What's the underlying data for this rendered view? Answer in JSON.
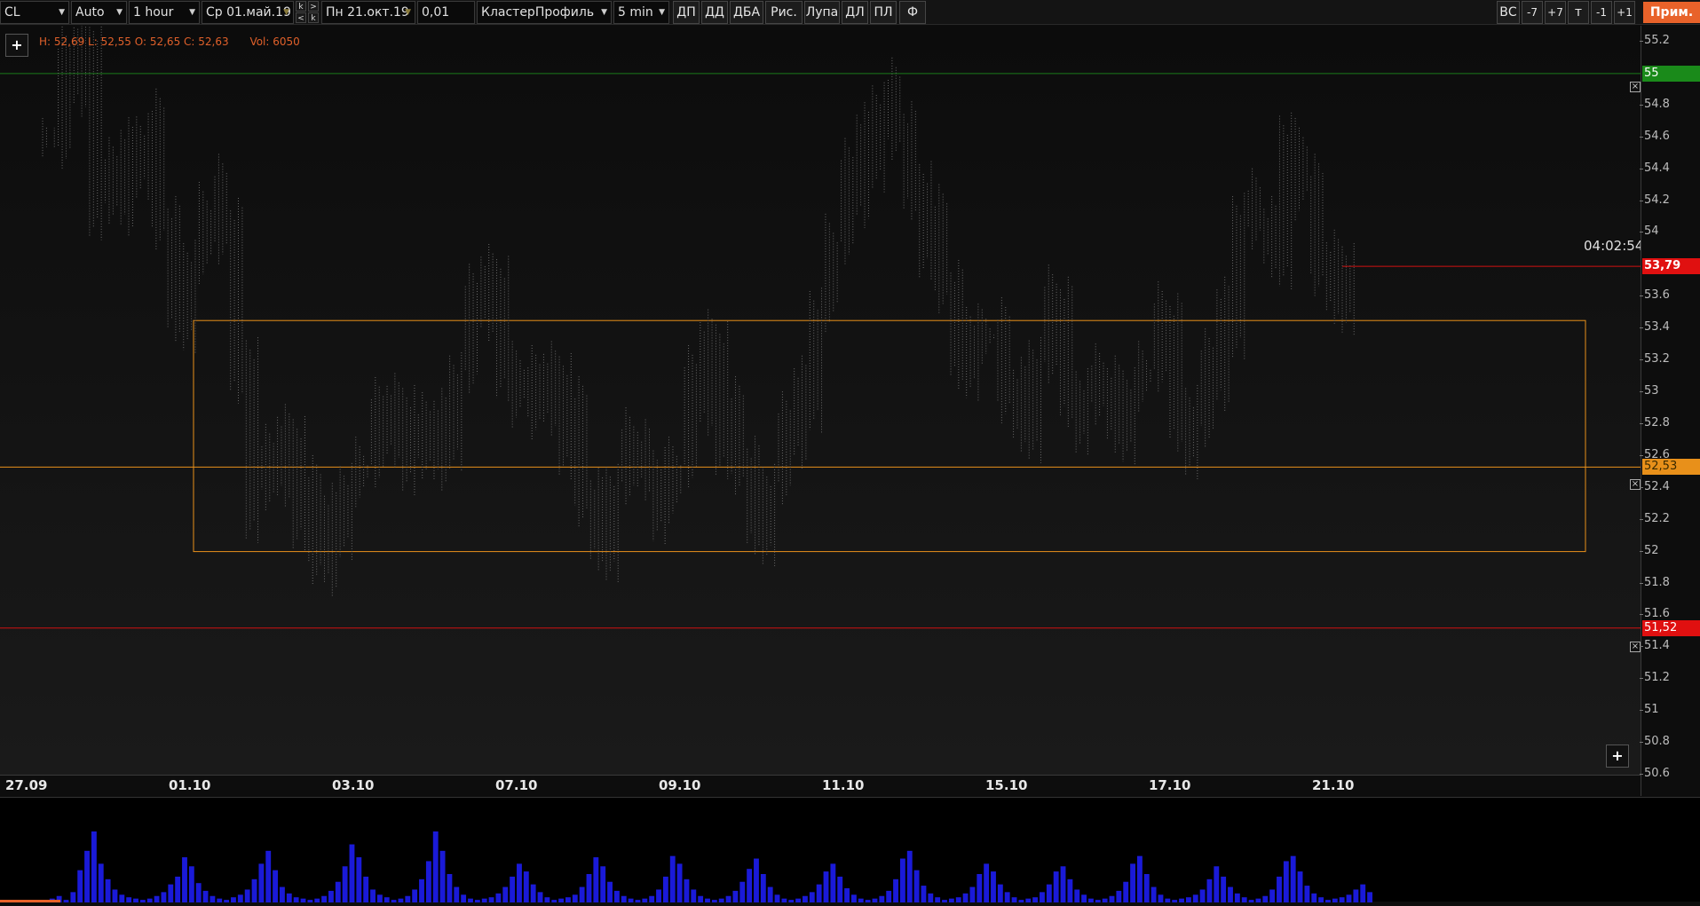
{
  "toolbar": {
    "symbol": "CL",
    "scale": "Auto",
    "timeframe": "1 hour",
    "date_from": "Ср 01.май.19",
    "date_to": "Пн 21.окт.19",
    "k_buttons": [
      ">",
      "<"
    ],
    "tick_size": "0,01",
    "indicator": "КластерПрофиль",
    "cluster_period": "5 min",
    "buttons": [
      "ДП",
      "ДД",
      "ДБА",
      "Рис.",
      "Лупа",
      "ДЛ",
      "ПЛ",
      "Ф"
    ],
    "right_buttons": [
      "ВС",
      "-7",
      "+7",
      "т",
      "-1",
      "+1"
    ],
    "prim_label": "Прим."
  },
  "chart_info": {
    "hl": "H: 52,69 L: 52,55 O: 52,65 C: 52,63",
    "vol": "Vol: 6050"
  },
  "timer": "04:02:54",
  "y_axis": {
    "ticks": [
      "55.2",
      "54.8",
      "54.6",
      "54.4",
      "54.2",
      "54",
      "53.6",
      "53.4",
      "53.2",
      "53",
      "52.8",
      "52.6",
      "52.4",
      "52.2",
      "52",
      "51.8",
      "51.6",
      "51.4",
      "51.2",
      "51",
      "50.8",
      "50.6"
    ]
  },
  "price_labels": [
    {
      "text": "55",
      "color": "#1a8a1a"
    },
    {
      "text": "53,79",
      "color": "#e01010"
    },
    {
      "text": "52,53",
      "color": "#e8901a"
    },
    {
      "text": "51,52",
      "color": "#e01010"
    }
  ],
  "x_axis": {
    "ticks": [
      "27.09",
      "01.10",
      "03.10",
      "07.10",
      "09.10",
      "11.10",
      "15.10",
      "17.10",
      "21.10"
    ]
  },
  "colors": {
    "support_line": "#d01010",
    "resistance_line": "#1a7a1a",
    "mid_line": "#e8901a",
    "rect": "#e8901a",
    "volume": "#1a1ad8",
    "accent": "#e8622a"
  },
  "chart_data": {
    "type": "bar",
    "description_units": "price",
    "ylim": [
      50.6,
      55.3
    ],
    "levels": [
      55,
      53.79,
      52.53,
      51.52
    ],
    "zone": [
      52.0,
      53.45
    ],
    "series": [
      {
        "name": "close",
        "values": [
          54.6,
          55.0,
          55.2,
          54.3,
          54.2,
          54.5,
          54.6,
          54.0,
          53.5,
          53.8,
          54.2,
          54.0,
          53.2,
          52.4,
          52.5,
          52.7,
          52.3,
          51.9,
          52.2,
          52.4,
          52.6,
          52.8,
          52.9,
          52.7,
          52.6,
          52.8,
          53.1,
          53.5,
          53.7,
          53.2,
          52.9,
          53.0,
          53.1,
          52.8,
          52.3,
          52.1,
          52.4,
          52.6,
          52.5,
          52.3,
          52.6,
          53.0,
          53.3,
          52.8,
          52.5,
          52.2,
          52.4,
          52.7,
          53.0,
          53.5,
          54.0,
          54.3,
          54.6,
          54.8,
          54.6,
          54.3,
          54.0,
          53.6,
          53.2,
          53.4,
          53.3,
          53.0,
          52.9,
          53.2,
          53.5,
          53.0,
          52.9,
          53.0,
          52.8,
          53.0,
          53.2,
          53.4,
          52.9,
          52.8,
          53.1,
          53.5,
          54.1,
          54.0,
          53.9,
          54.6,
          54.2,
          53.8,
          53.7,
          53.79
        ]
      }
    ]
  },
  "volume_data": [
    2,
    3,
    5,
    2,
    8,
    25,
    40,
    55,
    30,
    18,
    10,
    6,
    4,
    3,
    2,
    3,
    5,
    8,
    14,
    20,
    35,
    28,
    15,
    9,
    5,
    3,
    2,
    4,
    6,
    10,
    18,
    30,
    40,
    25,
    12,
    7,
    4,
    3,
    2,
    3,
    5,
    9,
    16,
    28,
    45,
    35,
    20,
    10,
    6,
    4,
    2,
    3,
    5,
    10,
    18,
    32,
    55,
    40,
    22,
    12,
    6,
    3,
    2,
    3,
    4,
    7,
    12,
    20,
    30,
    24,
    14,
    8,
    4,
    2,
    3,
    4,
    6,
    12,
    22,
    35,
    28,
    16,
    9,
    5,
    3,
    2,
    3,
    5,
    10,
    20,
    36,
    30,
    18,
    10,
    5,
    3,
    2,
    3,
    5,
    9,
    16,
    26,
    34,
    22,
    12,
    6,
    3,
    2,
    3,
    5,
    8,
    14,
    24,
    30,
    20,
    11,
    6,
    3,
    2,
    3,
    5,
    9,
    18,
    34,
    40,
    25,
    13,
    7,
    4,
    2,
    3,
    4,
    7,
    12,
    22,
    30,
    24,
    14,
    8,
    4,
    2,
    3,
    4,
    8,
    14,
    24,
    28,
    18,
    10,
    6,
    3,
    2,
    3,
    5,
    9,
    16,
    30,
    36,
    22,
    12,
    6,
    3,
    2,
    3,
    4,
    6,
    10,
    18,
    28,
    20,
    12,
    7,
    4,
    2,
    3,
    5,
    10,
    20,
    32,
    36,
    24,
    13,
    7,
    4,
    2,
    3,
    4,
    6,
    10,
    14,
    8
  ]
}
